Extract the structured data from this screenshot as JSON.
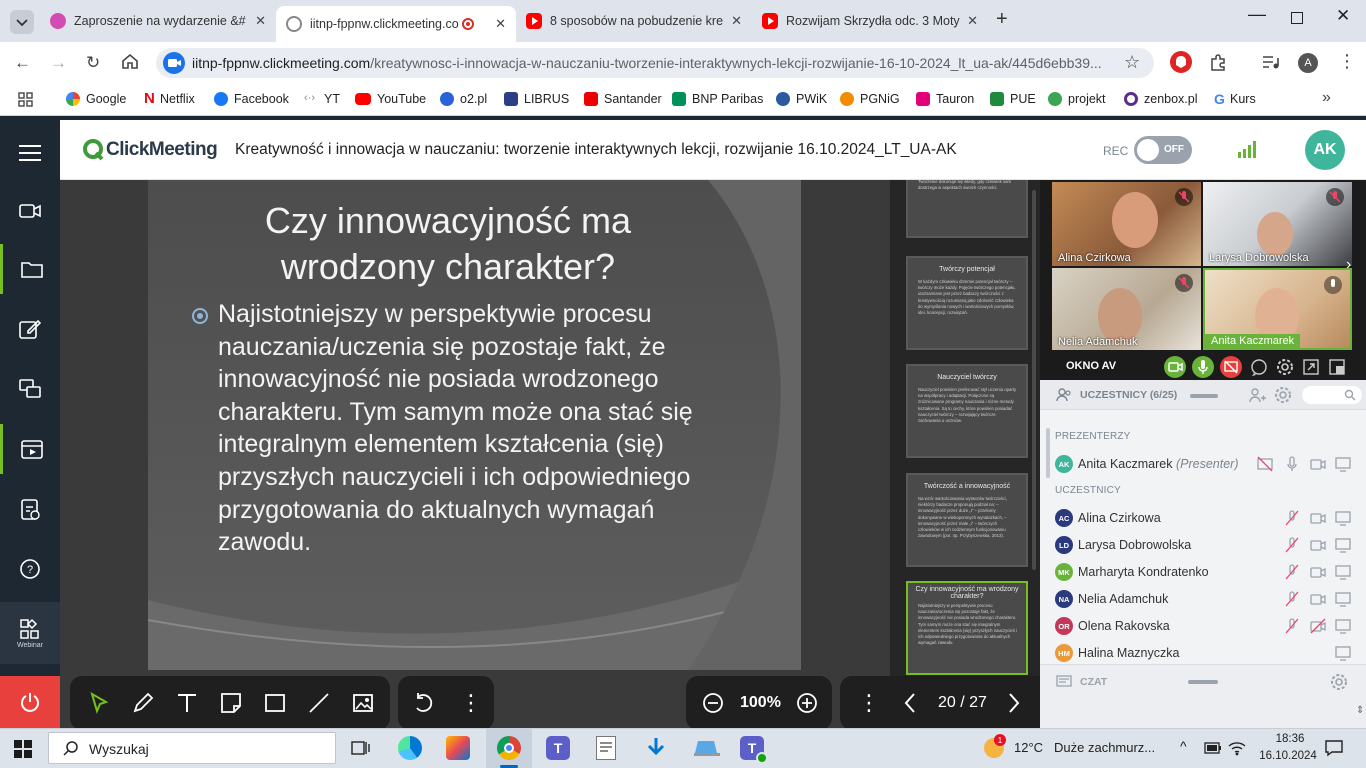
{
  "browser": {
    "tabs": [
      {
        "title": "Zaproszenie na wydarzenie &#",
        "close": "✕"
      },
      {
        "title": "iitnp-fppnw.clickmeeting.co",
        "close": "✕"
      },
      {
        "title": "8 sposobów na pobudzenie kre",
        "close": "✕"
      },
      {
        "title": "Rozwijam Skrzydła odc. 3 Moty",
        "close": "✕"
      }
    ],
    "new_tab": "+",
    "url_host": "iitnp-fppnw.clickmeeting.com",
    "url_path": "/kreatywnosc-i-innowacja-w-nauczaniu-tworzenie-interaktywnych-lekcji-rozwijanie-16-10-2024_lt_ua-ak/445d6ebb39...",
    "profile_initial": "A",
    "bookmarks": [
      "Google",
      "Netflix",
      "Facebook",
      "YT",
      "YouTube",
      "o2.pl",
      "LIBRUS",
      "Santander",
      "BNP Paribas",
      "PWiK",
      "PGNiG",
      "Tauron",
      "PUE",
      "projekt",
      "zenbox.pl",
      "Kurs"
    ],
    "more_bookmarks": "»"
  },
  "app": {
    "logo": "ClickMeeting",
    "title": "Kreatywność i innowacja w nauczaniu: tworzenie interaktywnych lekcji, rozwijanie 16.10.2024_LT_UA-AK",
    "rec_label": "REC",
    "rec_toggle": "OFF",
    "user_initials": "AK",
    "sidebar_webinar_label": "Webinar"
  },
  "slide": {
    "title": "Czy innowacyjność ma wrodzony charakter?",
    "bullet": "Najistotniejszy w perspektywie procesu nauczania/uczenia się pozostaje fakt, że innowacyjność nie posiada wrodzonego charakteru. Tym samym może ona stać się integralnym elementem kształcenia (się) przyszłych nauczycieli i ich odpowiedniego przygotowania do aktualnych wymagań zawodu."
  },
  "thumbnails": [
    {
      "title": "",
      "body": "dojrzewanie, wymaga rozwinięcia dyspozycji różnorodnych sposobami działania, gdy musi zastosować nowe sposoby rozwiązania problemu. To działanie całej osobowości: umysłu i motywacji. Tworzenie dokonuje się wtedy, gdy człowiek sam dostrzega w aspektach swoich czynności."
    },
    {
      "title": "Twórczy potencjał",
      "body": "W każdym człowieku drzemie potencjał twórczy – twórczy może każdy. Pojęcie twórczego potencjału, utożsamiane jest przez badaczy twórczości z kreatywnością rozumianą jako zdolność człowieka do wymyślania nowych i wartościowych pomysłów, idei, koncepcji, rozwiązań."
    },
    {
      "title": "Nauczyciel twórczy",
      "body": "Nauczyciel powinien preferować styl uczenia oparty na współpracy i adaptacji. Połączone są zróżnicowane programy nauczania i różne metody kształcenia. Są to cechy, które powinien posiadać nauczyciel twórczy – rozwijający twórcze zachowania u uczniów."
    },
    {
      "title": "Twórczość a innowacyjność",
      "body": "Na wzór wartościowania wytworów twórczości, niektórzy badacze proponują podział na: – innowacyjność przez duże „I” – przełomy dokonywane w wiekopomnych wynalazkach, – innowacyjność przez małe „i” – twórczych człowieków w ich codziennym funkcjonowaniu zawodowym (por. np. Przybyszewska, 2013)."
    },
    {
      "title": "Czy innowacyjność ma wrodzony charakter?",
      "body": "Najistotniejszy w perspektywie procesu nauczania/uczenia się pozostaje fakt, że innowacyjność nie posiada wrodzonego charakteru. Tym samym może ona stać się integralnym elementem kształcenia (się) przyszłych nauczycieli i ich odpowiedniego przygotowania do aktualnych wymagań zawodu."
    }
  ],
  "toolbar": {
    "zoom": "100%",
    "page_indicator": "20 / 27"
  },
  "video_panel": {
    "tiles": [
      "Alina Czirkowa",
      "Larysa Dobrowolska",
      "Nelia Adamchuk",
      "Anita Kaczmarek"
    ],
    "window_label": "OKNO AV"
  },
  "participants": {
    "header": "UCZESTNICY (6/25)",
    "presenters_label": "PREZENTERZY",
    "attendees_label": "UCZESTNICY",
    "presenter": {
      "initials": "AK",
      "name": "Anita Kaczmarek",
      "role": "(Presenter)",
      "color": "#3fb59c"
    },
    "list": [
      {
        "initials": "AC",
        "name": "Alina Czirkowa",
        "color": "#2a3a7c"
      },
      {
        "initials": "LD",
        "name": "Larysa Dobrowolska",
        "color": "#2a3a7c"
      },
      {
        "initials": "MK",
        "name": "Marharyta Kondratenko",
        "color": "#6ab33b"
      },
      {
        "initials": "NA",
        "name": "Nelia Adamchuk",
        "color": "#2a3a7c"
      },
      {
        "initials": "OR",
        "name": "Olena Rakovska",
        "color": "#c2375a"
      },
      {
        "initials": "HM",
        "name": "Halina Maznyczka",
        "color": "#e99a3a"
      }
    ],
    "chat_label": "CZAT"
  },
  "taskbar": {
    "search_placeholder": "Wyszukaj",
    "weather_temp": "12°C",
    "weather_desc": "Duże zachmurz...",
    "time": "18:36",
    "date": "16.10.2024",
    "notification_badge": "1"
  }
}
